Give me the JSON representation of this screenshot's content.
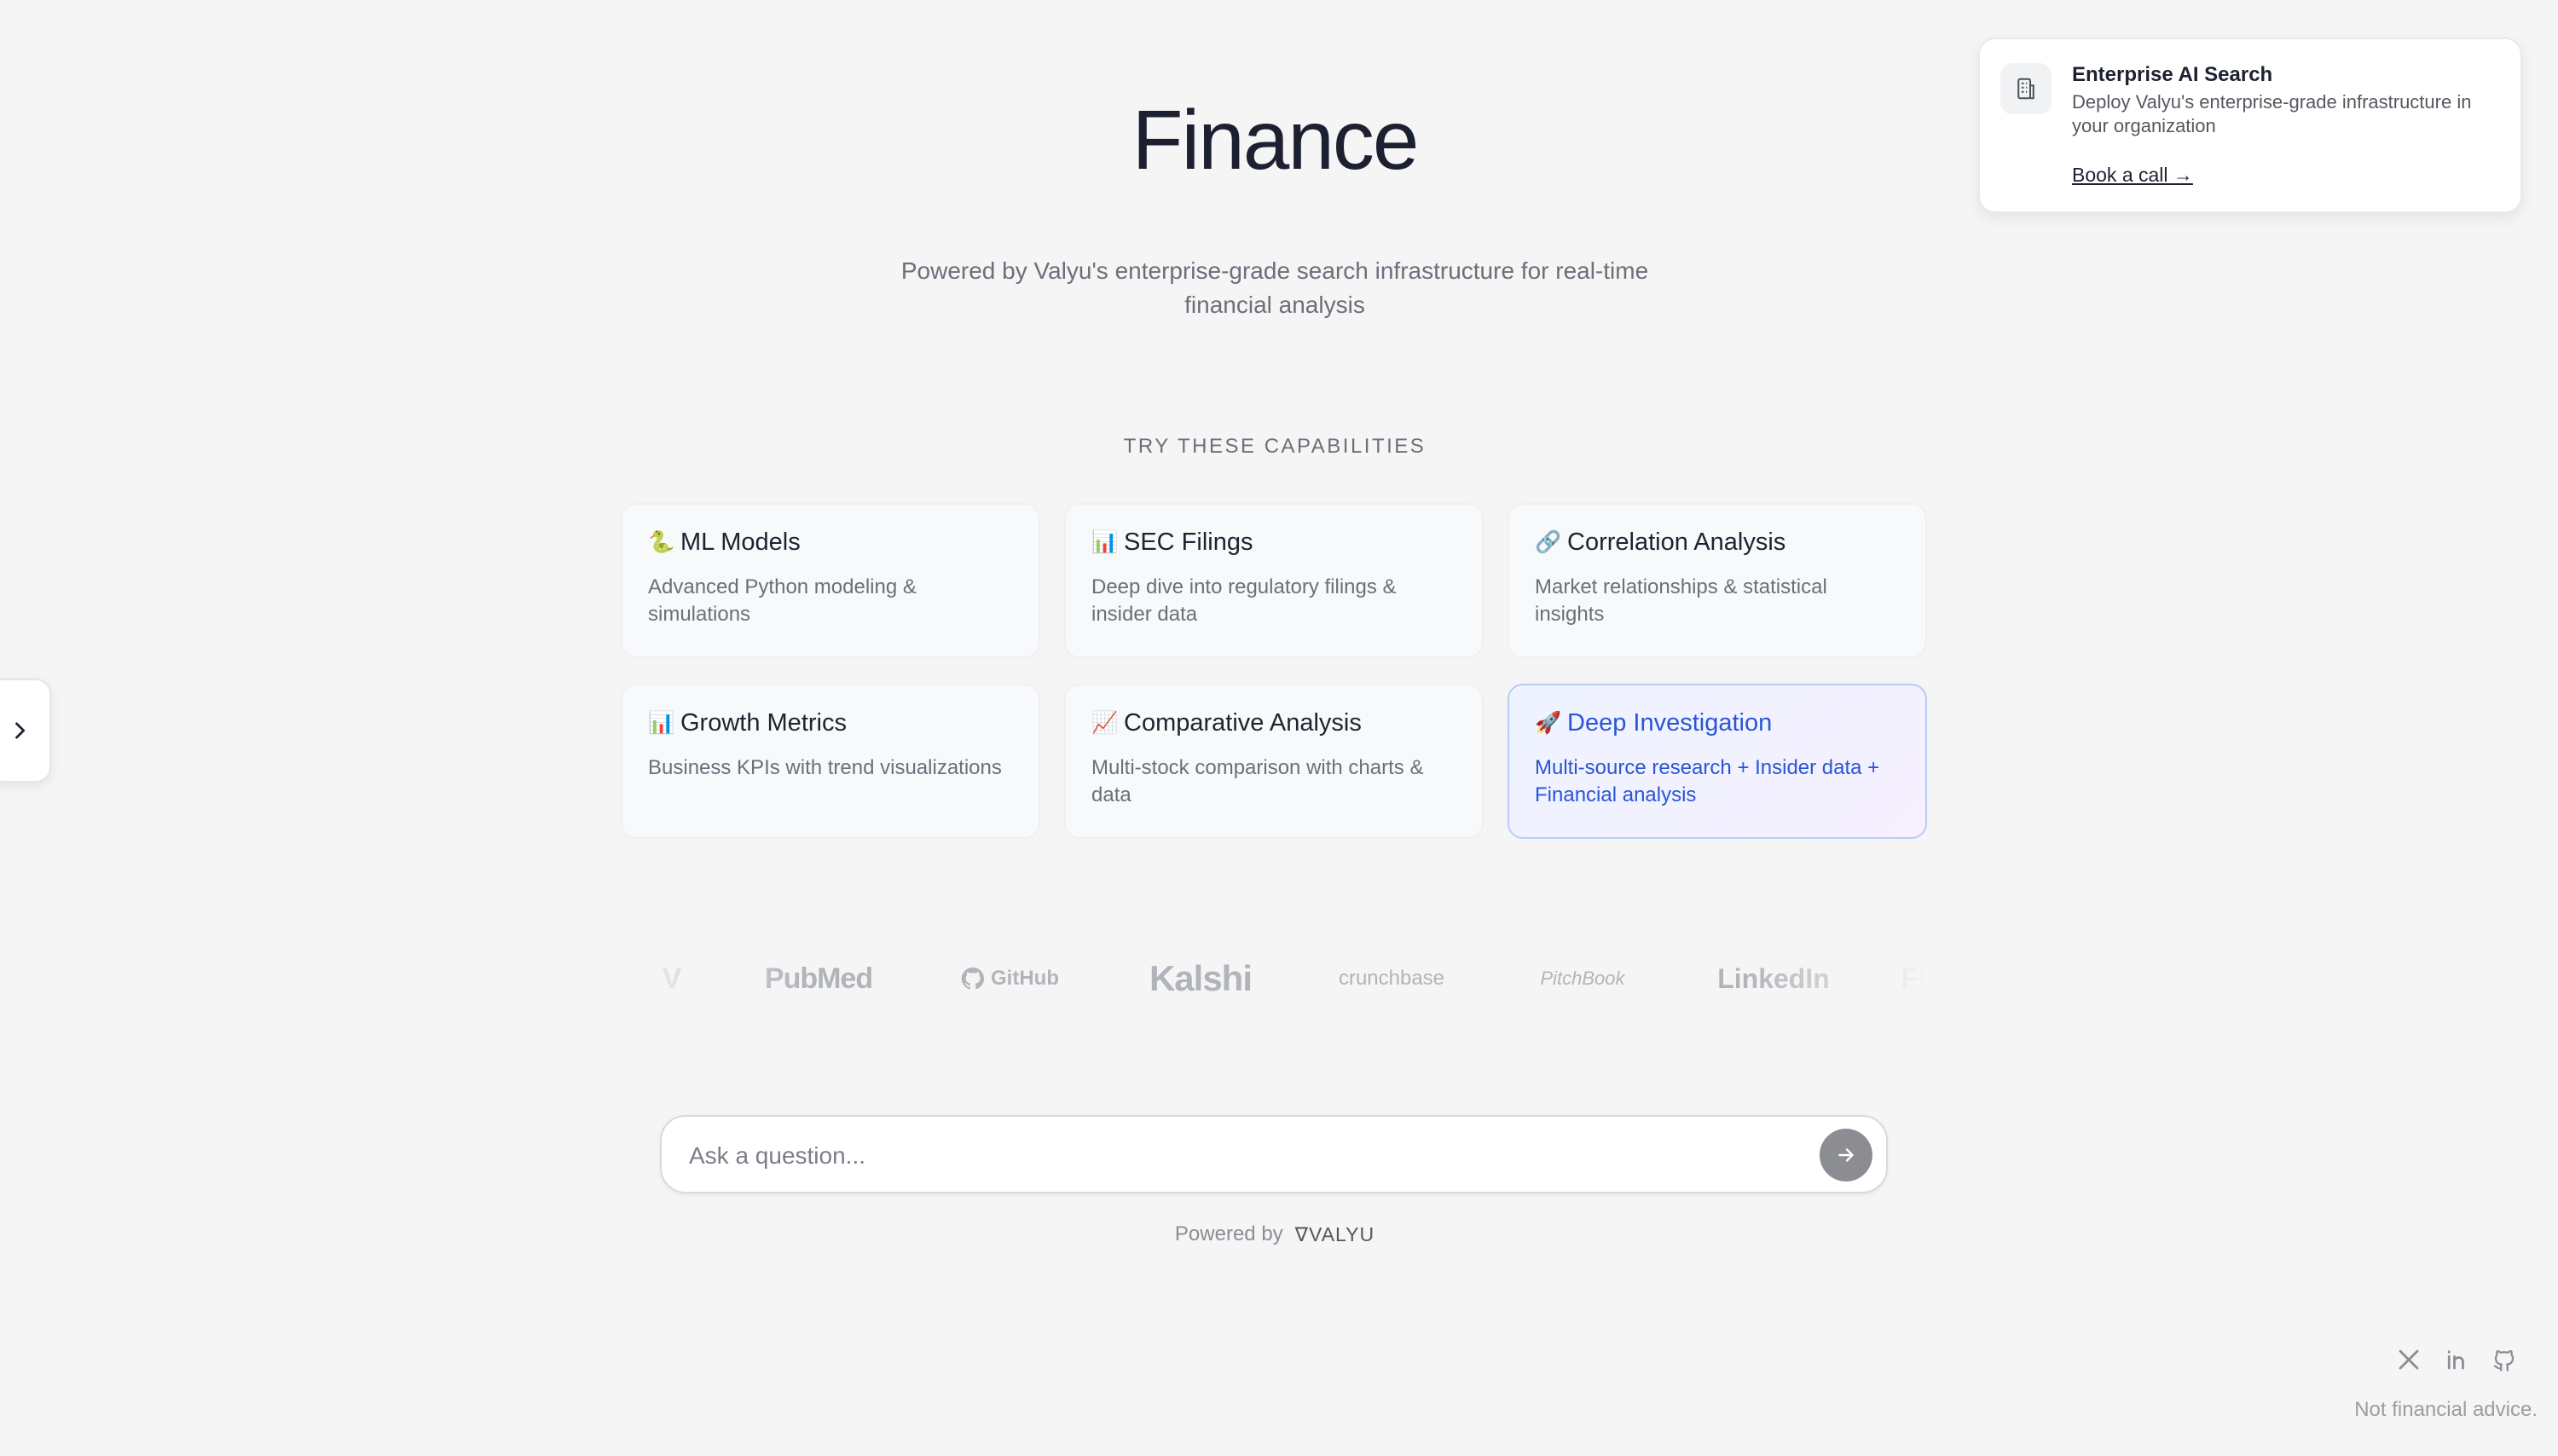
{
  "hero": {
    "title": "Finance",
    "subtitle": "Powered by Valyu's enterprise-grade search infrastructure for real-time financial analysis"
  },
  "capabilities": {
    "heading": "TRY THESE CAPABILITIES",
    "cards": [
      {
        "icon": "🐍",
        "icon_name": "snake-icon",
        "title": "ML Models",
        "description": "Advanced Python modeling & simulations"
      },
      {
        "icon": "📊",
        "icon_name": "bar-chart-icon",
        "title": "SEC Filings",
        "description": "Deep dive into regulatory filings & insider data"
      },
      {
        "icon": "🔗",
        "icon_name": "link-icon",
        "title": "Correlation Analysis",
        "description": "Market relationships & statistical insights"
      },
      {
        "icon": "📊",
        "icon_name": "bar-chart-icon",
        "title": "Growth Metrics",
        "description": "Business KPIs with trend visualizations"
      },
      {
        "icon": "📈",
        "icon_name": "trend-up-chart-icon",
        "title": "Comparative Analysis",
        "description": "Multi-stock comparison with charts & data"
      },
      {
        "icon": "🚀",
        "icon_name": "rocket-icon",
        "title": "Deep Investigation",
        "description": "Multi-source research + Insider data + Financial analysis",
        "highlighted": true
      }
    ]
  },
  "logos": [
    "PubMed",
    "GitHub",
    "Kalshi",
    "crunchbase",
    "PitchBook",
    "LinkedIn"
  ],
  "search": {
    "placeholder": "Ask a question...",
    "powered_by": "Powered by",
    "brand": "∇VALYU"
  },
  "promo": {
    "title": "Enterprise AI Search",
    "description": "Deploy Valyu's enterprise-grade infrastructure in your organization",
    "link": "Book a call →"
  },
  "footer": {
    "disclaimer": "Not financial advice.",
    "social_icons": [
      "x-icon",
      "linkedin-icon",
      "github-icon"
    ]
  },
  "colors": {
    "background": "#f5f5f5",
    "accent": "#2a55d4",
    "send_button": "#8b8d93"
  }
}
